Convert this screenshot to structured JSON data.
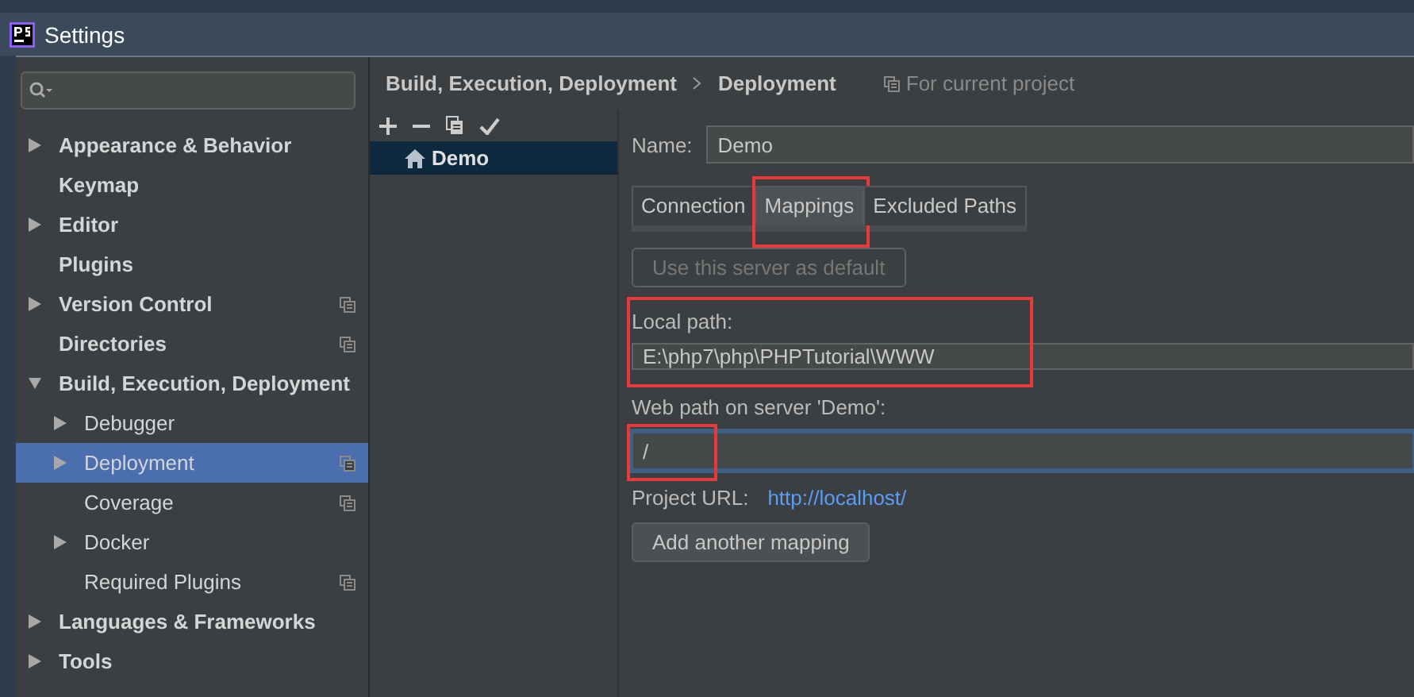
{
  "window": {
    "title": "Settings"
  },
  "sidebar": {
    "items": [
      {
        "label": "Appearance & Behavior",
        "expandable": true,
        "expanded": false,
        "selected": false,
        "project_scope": false
      },
      {
        "label": "Keymap",
        "expandable": false,
        "selected": false,
        "project_scope": false
      },
      {
        "label": "Editor",
        "expandable": true,
        "expanded": false,
        "selected": false,
        "project_scope": false
      },
      {
        "label": "Plugins",
        "expandable": false,
        "selected": false,
        "project_scope": false
      },
      {
        "label": "Version Control",
        "expandable": true,
        "expanded": false,
        "selected": false,
        "project_scope": true
      },
      {
        "label": "Directories",
        "expandable": false,
        "selected": false,
        "project_scope": true
      },
      {
        "label": "Build, Execution, Deployment",
        "expandable": true,
        "expanded": true,
        "selected": false,
        "project_scope": false,
        "children": [
          {
            "label": "Debugger",
            "expandable": true,
            "expanded": false,
            "selected": false,
            "project_scope": false
          },
          {
            "label": "Deployment",
            "expandable": true,
            "expanded": false,
            "selected": true,
            "project_scope": true
          },
          {
            "label": "Coverage",
            "expandable": false,
            "selected": false,
            "project_scope": true
          },
          {
            "label": "Docker",
            "expandable": true,
            "expanded": false,
            "selected": false,
            "project_scope": false
          },
          {
            "label": "Required Plugins",
            "expandable": false,
            "selected": false,
            "project_scope": true
          }
        ]
      },
      {
        "label": "Languages & Frameworks",
        "expandable": true,
        "expanded": false,
        "selected": false,
        "project_scope": false
      },
      {
        "label": "Tools",
        "expandable": true,
        "expanded": false,
        "selected": false,
        "project_scope": false
      }
    ]
  },
  "breadcrumb": [
    "Build, Execution, Deployment",
    "Deployment"
  ],
  "scope_note": "For current project",
  "servers": [
    {
      "name": "Demo",
      "selected": true
    }
  ],
  "form": {
    "name_label": "Name:",
    "name_value": "Demo",
    "tabs": [
      {
        "label": "Connection",
        "selected": false,
        "highlighted": false
      },
      {
        "label": "Mappings",
        "selected": true,
        "highlighted": true
      },
      {
        "label": "Excluded Paths",
        "selected": false,
        "highlighted": false
      }
    ],
    "default_button": {
      "label": "Use this server as default",
      "disabled": true
    },
    "local_path": {
      "label": "Local path:",
      "value": "E:\\php7\\php\\PHPTutorial\\WWW",
      "highlighted": true
    },
    "web_path": {
      "label": "Web path on server 'Demo':",
      "value": "/",
      "focused": true,
      "highlighted": true
    },
    "project_url": {
      "label": "Project URL:",
      "link": "http://localhost/"
    },
    "add_button": {
      "label": "Add another mapping"
    }
  }
}
